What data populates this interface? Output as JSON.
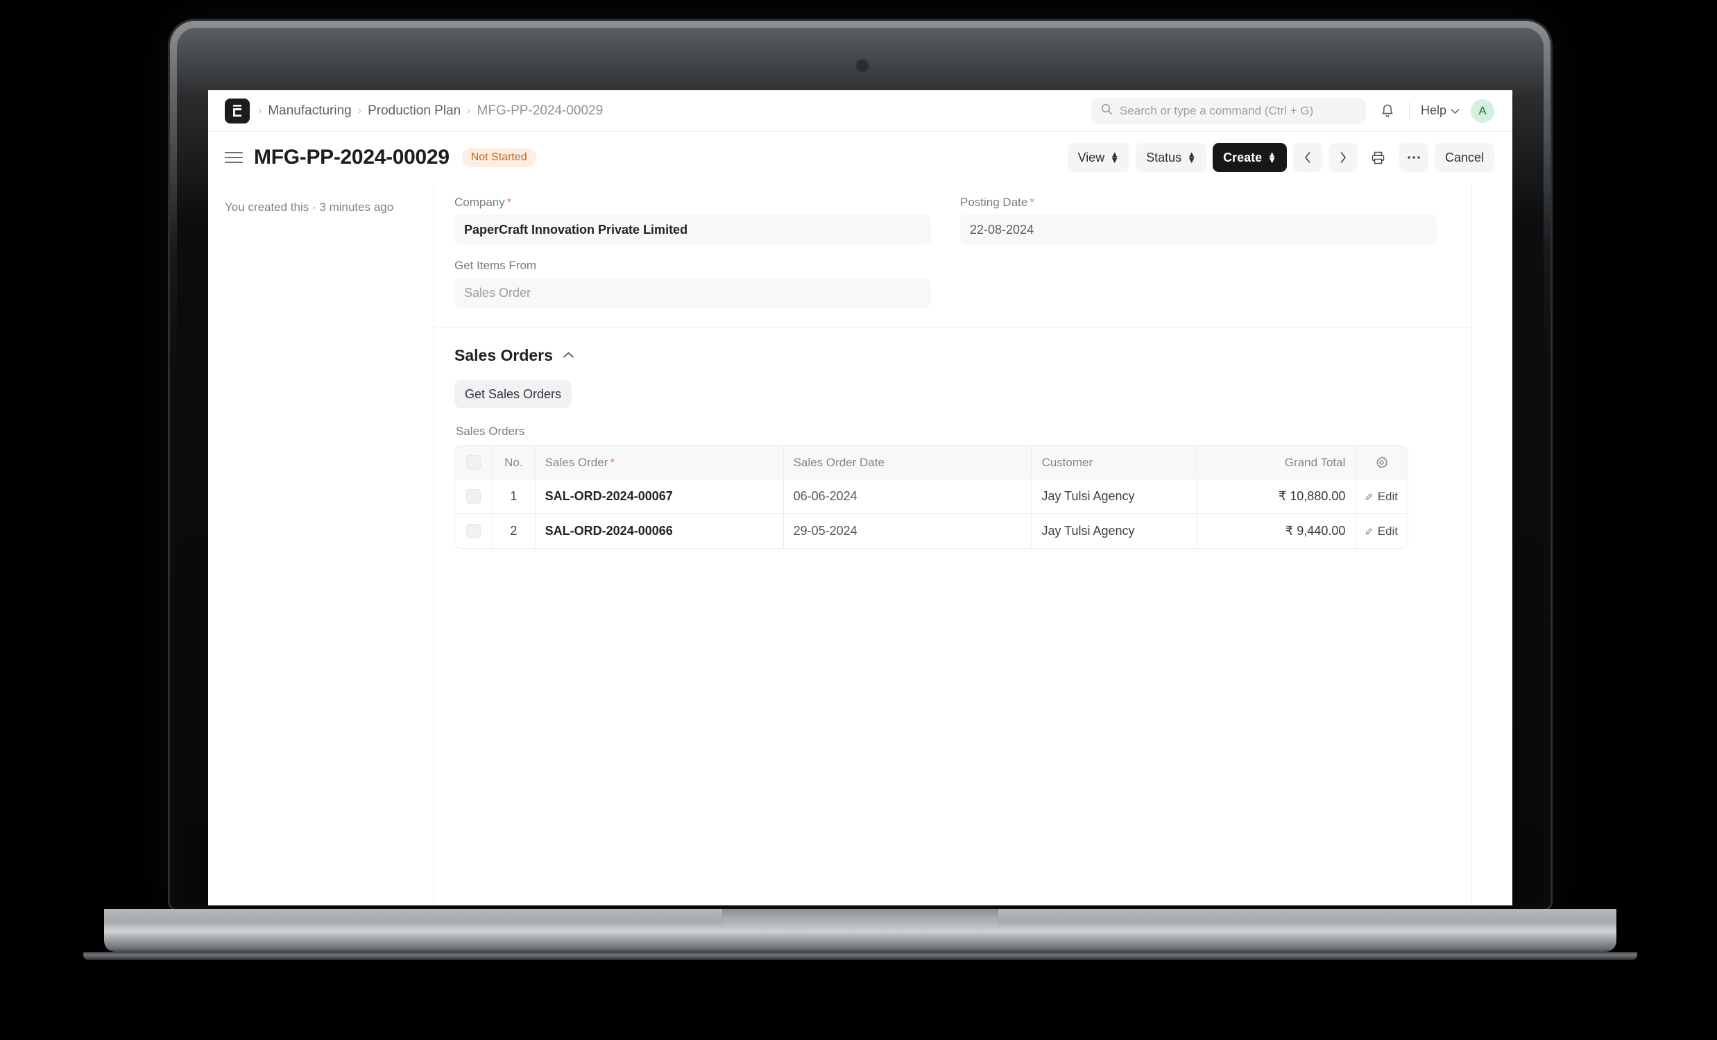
{
  "navbar": {
    "logo_icon": "erpnext-logo-icon",
    "breadcrumb": [
      {
        "label": "Manufacturing",
        "current": false
      },
      {
        "label": "Production Plan",
        "current": false
      },
      {
        "label": "MFG-PP-2024-00029",
        "current": true
      }
    ],
    "search": {
      "icon": "search-icon",
      "placeholder": "Search or type a command (Ctrl + G)"
    },
    "notifications_icon": "bell-icon",
    "help_label": "Help",
    "help_chevron_icon": "chevron-down-icon",
    "avatar_initial": "A"
  },
  "titlebar": {
    "menu_icon": "hamburger-icon",
    "title": "MFG-PP-2024-00029",
    "status": "Not Started",
    "actions": {
      "view_label": "View",
      "status_label": "Status",
      "create_label": "Create",
      "prev_icon": "chevron-left-icon",
      "next_icon": "chevron-right-icon",
      "print_icon": "printer-icon",
      "more_icon": "ellipsis-icon",
      "cancel_label": "Cancel"
    }
  },
  "sidebar": {
    "note": "You created this · 3 minutes ago"
  },
  "form": {
    "company": {
      "label": "Company",
      "required": "*",
      "value": "PaperCraft Innovation Private Limited"
    },
    "posting_date": {
      "label": "Posting Date",
      "required": "*",
      "value": "22-08-2024"
    },
    "get_items_from": {
      "label": "Get Items From",
      "placeholder": "Sales Order"
    }
  },
  "sales_orders_section": {
    "title": "Sales Orders",
    "collapse_icon": "chevron-up-icon",
    "get_button_label": "Get Sales Orders",
    "grid_label": "Sales Orders",
    "settings_icon": "gear-icon",
    "columns": {
      "no": "No.",
      "sales_order": "Sales Order",
      "sales_order_required": "*",
      "sales_order_date": "Sales Order Date",
      "customer": "Customer",
      "grand_total": "Grand Total"
    },
    "edit_label": "Edit",
    "rows": [
      {
        "no": "1",
        "sales_order": "SAL-ORD-2024-00067",
        "sales_order_date": "06-06-2024",
        "customer": "Jay Tulsi Agency",
        "grand_total": "₹ 10,880.00"
      },
      {
        "no": "2",
        "sales_order": "SAL-ORD-2024-00066",
        "sales_order_date": "29-05-2024",
        "customer": "Jay Tulsi Agency",
        "grand_total": "₹ 9,440.00"
      }
    ]
  },
  "colors": {
    "primary_button": "#171717",
    "status_badge_text": "#c9630f",
    "status_badge_bg": "#fdeee4",
    "avatar_bg": "#d4f0dd",
    "required_marker": "#e8846e"
  }
}
